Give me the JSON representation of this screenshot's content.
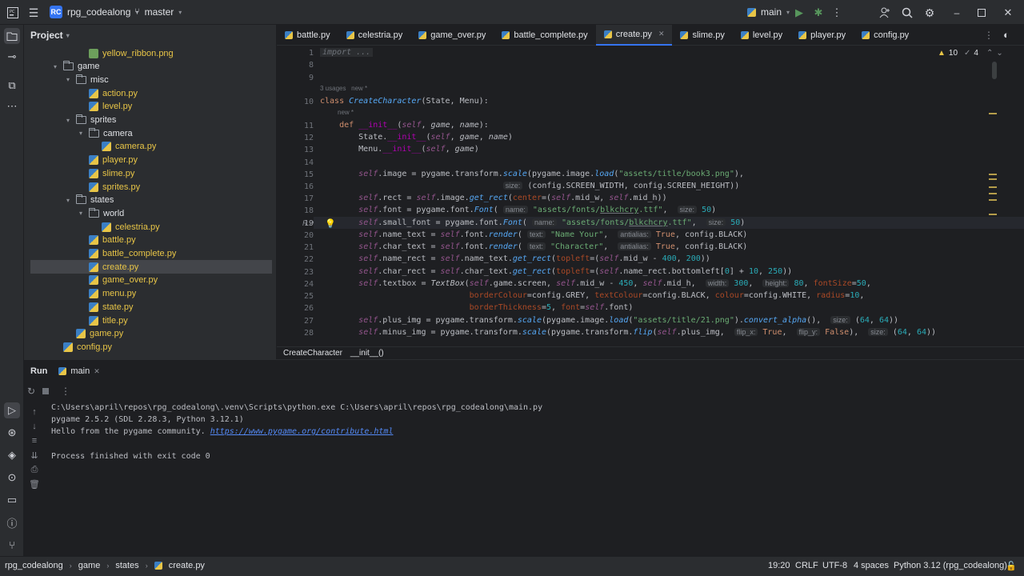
{
  "titlebar": {
    "project_badge": "RC",
    "project_name": "rpg_codealong",
    "vcs_branch": "master",
    "run_config": "main"
  },
  "project_panel": {
    "title": "Project",
    "items": [
      {
        "label": "yellow_ribbon.png",
        "kind": "png",
        "depth": 3
      },
      {
        "label": "game",
        "kind": "folder",
        "depth": 1
      },
      {
        "label": "misc",
        "kind": "folder",
        "depth": 2
      },
      {
        "label": "action.py",
        "kind": "py",
        "depth": 3
      },
      {
        "label": "level.py",
        "kind": "py",
        "depth": 3
      },
      {
        "label": "sprites",
        "kind": "folder",
        "depth": 2
      },
      {
        "label": "camera",
        "kind": "folder",
        "depth": 3
      },
      {
        "label": "camera.py",
        "kind": "py",
        "depth": 4
      },
      {
        "label": "player.py",
        "kind": "py",
        "depth": 3
      },
      {
        "label": "slime.py",
        "kind": "py",
        "depth": 3
      },
      {
        "label": "sprites.py",
        "kind": "py",
        "depth": 3
      },
      {
        "label": "states",
        "kind": "folder",
        "depth": 2
      },
      {
        "label": "world",
        "kind": "folder",
        "depth": 3
      },
      {
        "label": "celestria.py",
        "kind": "py",
        "depth": 4
      },
      {
        "label": "battle.py",
        "kind": "py",
        "depth": 3
      },
      {
        "label": "battle_complete.py",
        "kind": "py",
        "depth": 3
      },
      {
        "label": "create.py",
        "kind": "py",
        "depth": 3,
        "selected": true
      },
      {
        "label": "game_over.py",
        "kind": "py",
        "depth": 3
      },
      {
        "label": "menu.py",
        "kind": "py",
        "depth": 3
      },
      {
        "label": "state.py",
        "kind": "py",
        "depth": 3
      },
      {
        "label": "title.py",
        "kind": "py",
        "depth": 3
      },
      {
        "label": "game.py",
        "kind": "py",
        "depth": 2
      },
      {
        "label": "config.py",
        "kind": "py",
        "depth": 1
      }
    ]
  },
  "tabs": [
    "battle.py",
    "celestria.py",
    "game_over.py",
    "battle_complete.py",
    "create.py",
    "slime.py",
    "level.py",
    "player.py",
    "config.py"
  ],
  "active_tab": "create.py",
  "inspections": {
    "warnings": "10",
    "weak": "4"
  },
  "line_numbers": [
    "1",
    "8",
    "9",
    "10",
    "11",
    "12",
    "13",
    "14",
    "15",
    "16",
    "17",
    "18",
    "19",
    "20",
    "21",
    "22",
    "23",
    "24",
    "25",
    "26",
    "27",
    "28"
  ],
  "code_meta": {
    "import_fold": "import ...",
    "usages": "3 usages   new *",
    "new_hint": "new *"
  },
  "editor_breadcrumbs": [
    "CreateCharacter",
    "__init__()"
  ],
  "run_panel": {
    "tab_run": "Run",
    "tab_main": "main",
    "lines": [
      "C:\\Users\\april\\repos\\rpg_codealong\\.venv\\Scripts\\python.exe C:\\Users\\april\\repos\\rpg_codealong\\main.py",
      "pygame 2.5.2 (SDL 2.28.3, Python 3.12.1)",
      "Hello from the pygame community. ",
      "",
      "Process finished with exit code 0"
    ],
    "link": "https://www.pygame.org/contribute.html"
  },
  "statusbar": {
    "path": [
      "rpg_codealong",
      "game",
      "states",
      "create.py"
    ],
    "position": "19:20",
    "line_sep": "CRLF",
    "encoding": "UTF-8",
    "indent": "4 spaces",
    "interpreter": "Python 3.12 (rpg_codealong)"
  }
}
